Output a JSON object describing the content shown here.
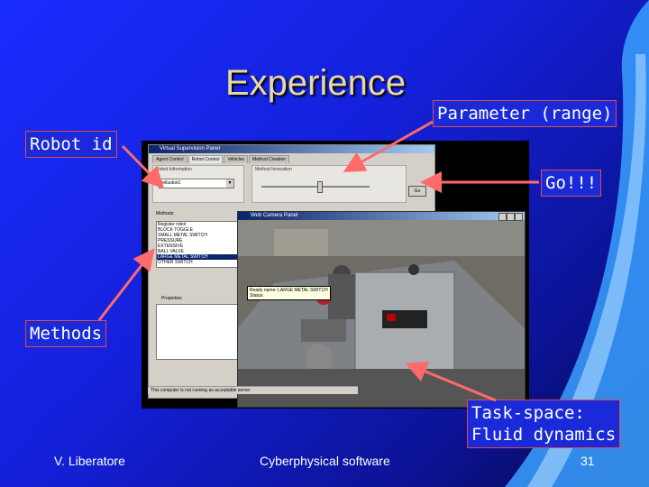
{
  "slide": {
    "title": "Experience",
    "callouts": {
      "robot_id": "Robot id",
      "parameter": "Parameter (range)",
      "go": "Go!!!",
      "methods": "Methods",
      "task_space_line1": "Task-space:",
      "task_space_line2": "Fluid dynamics"
    },
    "footer": {
      "author": "V. Liberatore",
      "course": "Cyberphysical software",
      "page": "31"
    }
  },
  "screenshot": {
    "window_title": "Virtual Supervision Panel",
    "tabs": [
      "Agent Control",
      "Robot Control",
      "Vehicles",
      "Method Creation"
    ],
    "robot_info_label": "Robot Information",
    "robot_id_value": "tellusbot1",
    "method_invocation_label": "Method Invocation",
    "go_label": "Go",
    "methods_label": "Methods:",
    "methods": [
      "Register robot",
      "BLOCK TOGGLE",
      "SMALL METAL SWITCH",
      "PRESSURE",
      "EXTENSIVE",
      "BALL VALVE",
      "LARGE METAL SWITCH",
      "OTHER SWITCH"
    ],
    "selected_method_index": 6,
    "properties_label": "Properties",
    "status_text": "This computer is not running as acceptable server",
    "camera_title": "Web Camera Panel",
    "tooltip_line1": "Ready name: LARGE METAL SWITCH",
    "tooltip_line2": "Status:"
  },
  "colors": {
    "callout_border": "#e04a4a",
    "arrow": "#ff6b6b",
    "title": "#e8d9a0"
  }
}
